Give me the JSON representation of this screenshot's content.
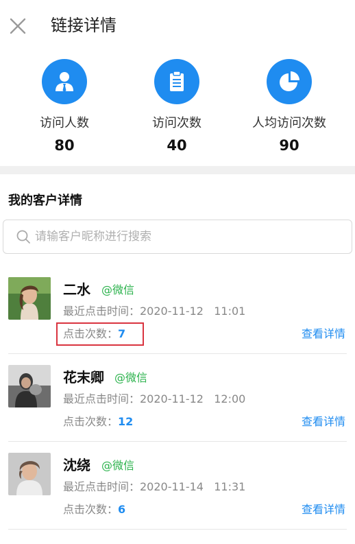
{
  "header": {
    "title": "链接详情",
    "close_icon": "close-icon"
  },
  "stats": [
    {
      "icon": "user-icon",
      "label": "访问人数",
      "value": "80"
    },
    {
      "icon": "clipboard-icon",
      "label": "访问次数",
      "value": "40"
    },
    {
      "icon": "pie-chart-icon",
      "label": "人均访问次数",
      "value": "90"
    }
  ],
  "section": {
    "title": "我的客户详情"
  },
  "search": {
    "placeholder": "请输客户昵称进行搜索",
    "value": ""
  },
  "customers": [
    {
      "name": "二水",
      "source": "@微信",
      "last_click": "最近点击时间：2020-11-12   11:01",
      "click_label": "点击次数：",
      "click_count": "7",
      "detail_label": "查看详情",
      "highlighted": true
    },
    {
      "name": "花末卿",
      "source": "@微信",
      "last_click": "最近点击时间：2020-11-12   12:00",
      "click_label": "点击次数：",
      "click_count": "12",
      "detail_label": "查看详情",
      "highlighted": false
    },
    {
      "name": "沈绕",
      "source": "@微信",
      "last_click": "最近点击时间：2020-11-14   11:31",
      "click_label": "点击次数：",
      "click_count": "6",
      "detail_label": "查看详情",
      "highlighted": false
    }
  ],
  "colors": {
    "accent": "#1f8cf0",
    "wechat_green": "#2bb24c",
    "highlight_red": "#d9333f"
  }
}
